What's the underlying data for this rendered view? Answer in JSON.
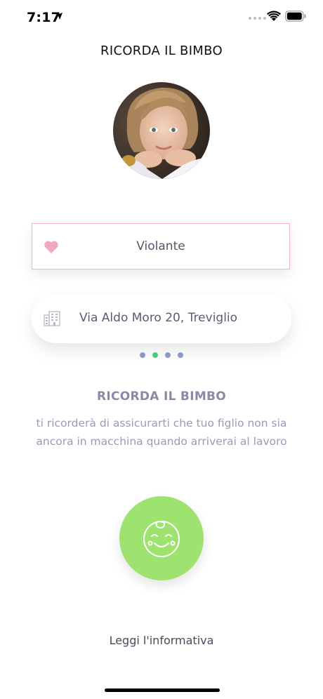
{
  "status_bar": {
    "time": "7:17"
  },
  "header": {
    "title": "RICORDA IL BIMBO"
  },
  "form": {
    "child_name": "Violante",
    "address": "Via Aldo Moro 20, Treviglio"
  },
  "carousel": {
    "pages": 4,
    "active_index": 1,
    "active_color": "#4cc97a",
    "inactive_color": "#8b99c7"
  },
  "info": {
    "title": "RICORDA IL BIMBO",
    "line1": "ti ricorderà di assicurarti che tuo figlio non sia",
    "line2": "ancora in macchina quando arriverai al lavoro"
  },
  "actions": {
    "privacy_link": "Leggi l'informativa"
  },
  "colors": {
    "accent_green": "#9ee36f",
    "heart_pink": "#f1a9bd",
    "field_border": "#f1b6c2"
  },
  "icons": {
    "name_field": "heart-icon",
    "address_field": "building-icon",
    "main_button": "baby-face-icon"
  }
}
